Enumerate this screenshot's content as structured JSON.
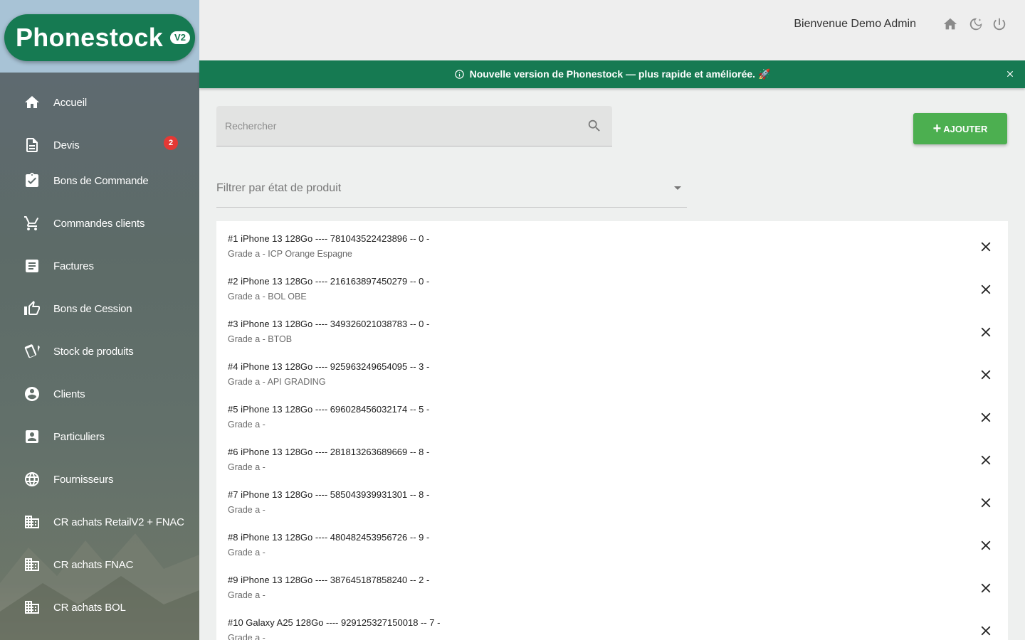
{
  "app": {
    "logo": "Phonestock",
    "version_badge": "V2"
  },
  "sidebar": {
    "items": [
      {
        "label": "Accueil",
        "icon": "home-icon"
      },
      {
        "label": "Devis",
        "icon": "document-icon"
      },
      {
        "label": "Bons de Commande",
        "icon": "clipboard-check-icon"
      },
      {
        "label": "Commandes clients",
        "icon": "cart-icon",
        "badge": "2"
      },
      {
        "label": "Factures",
        "icon": "invoice-icon"
      },
      {
        "label": "Bons de Cession",
        "icon": "thumb-up-icon"
      },
      {
        "label": "Stock de produits",
        "icon": "cards-icon"
      },
      {
        "label": "Clients",
        "icon": "account-circle-icon"
      },
      {
        "label": "Particuliers",
        "icon": "contact-card-icon"
      },
      {
        "label": "Fournisseurs",
        "icon": "globe-icon"
      },
      {
        "label": "CR achats RetailV2 + FNAC",
        "icon": "building-icon"
      },
      {
        "label": "CR achats FNAC",
        "icon": "building-icon"
      },
      {
        "label": "CR achats BOL",
        "icon": "building-icon"
      }
    ]
  },
  "header": {
    "welcome": "Bienvenue Demo Admin",
    "icons": [
      "home-icon",
      "dark-mode-icon",
      "power-icon"
    ]
  },
  "banner": {
    "text": "Nouvelle version de Phonestock — plus rapide et améliorée. 🚀"
  },
  "search": {
    "placeholder": "Rechercher"
  },
  "add_button": {
    "label": "AJOUTER"
  },
  "filter": {
    "label": "Filtrer par état de produit"
  },
  "products": [
    {
      "title": "#1 iPhone 13 128Go ---- 781043522423896 -- 0 -",
      "subtitle": "Grade a - ICP Orange Espagne"
    },
    {
      "title": "#2 iPhone 13 128Go ---- 216163897450279 -- 0 -",
      "subtitle": "Grade a - BOL OBE"
    },
    {
      "title": "#3 iPhone 13 128Go ---- 349326021038783 -- 0 -",
      "subtitle": "Grade a - BTOB"
    },
    {
      "title": "#4 iPhone 13 128Go ---- 925963249654095 -- 3 -",
      "subtitle": "Grade a - API GRADING"
    },
    {
      "title": "#5 iPhone 13 128Go ---- 696028456032174 -- 5 -",
      "subtitle": "Grade a -"
    },
    {
      "title": "#6 iPhone 13 128Go ---- 281813263689669 -- 8 -",
      "subtitle": "Grade a -"
    },
    {
      "title": "#7 iPhone 13 128Go ---- 585043939931301 -- 8 -",
      "subtitle": "Grade a -"
    },
    {
      "title": "#8 iPhone 13 128Go ---- 480482453956726 -- 9 -",
      "subtitle": "Grade a -"
    },
    {
      "title": "#9 iPhone 13 128Go ---- 387645187858240 -- 2 -",
      "subtitle": "Grade a -"
    },
    {
      "title": "#10 Galaxy A25 128Go ---- 929125327150018 -- 7 -",
      "subtitle": "Grade a -"
    }
  ]
}
